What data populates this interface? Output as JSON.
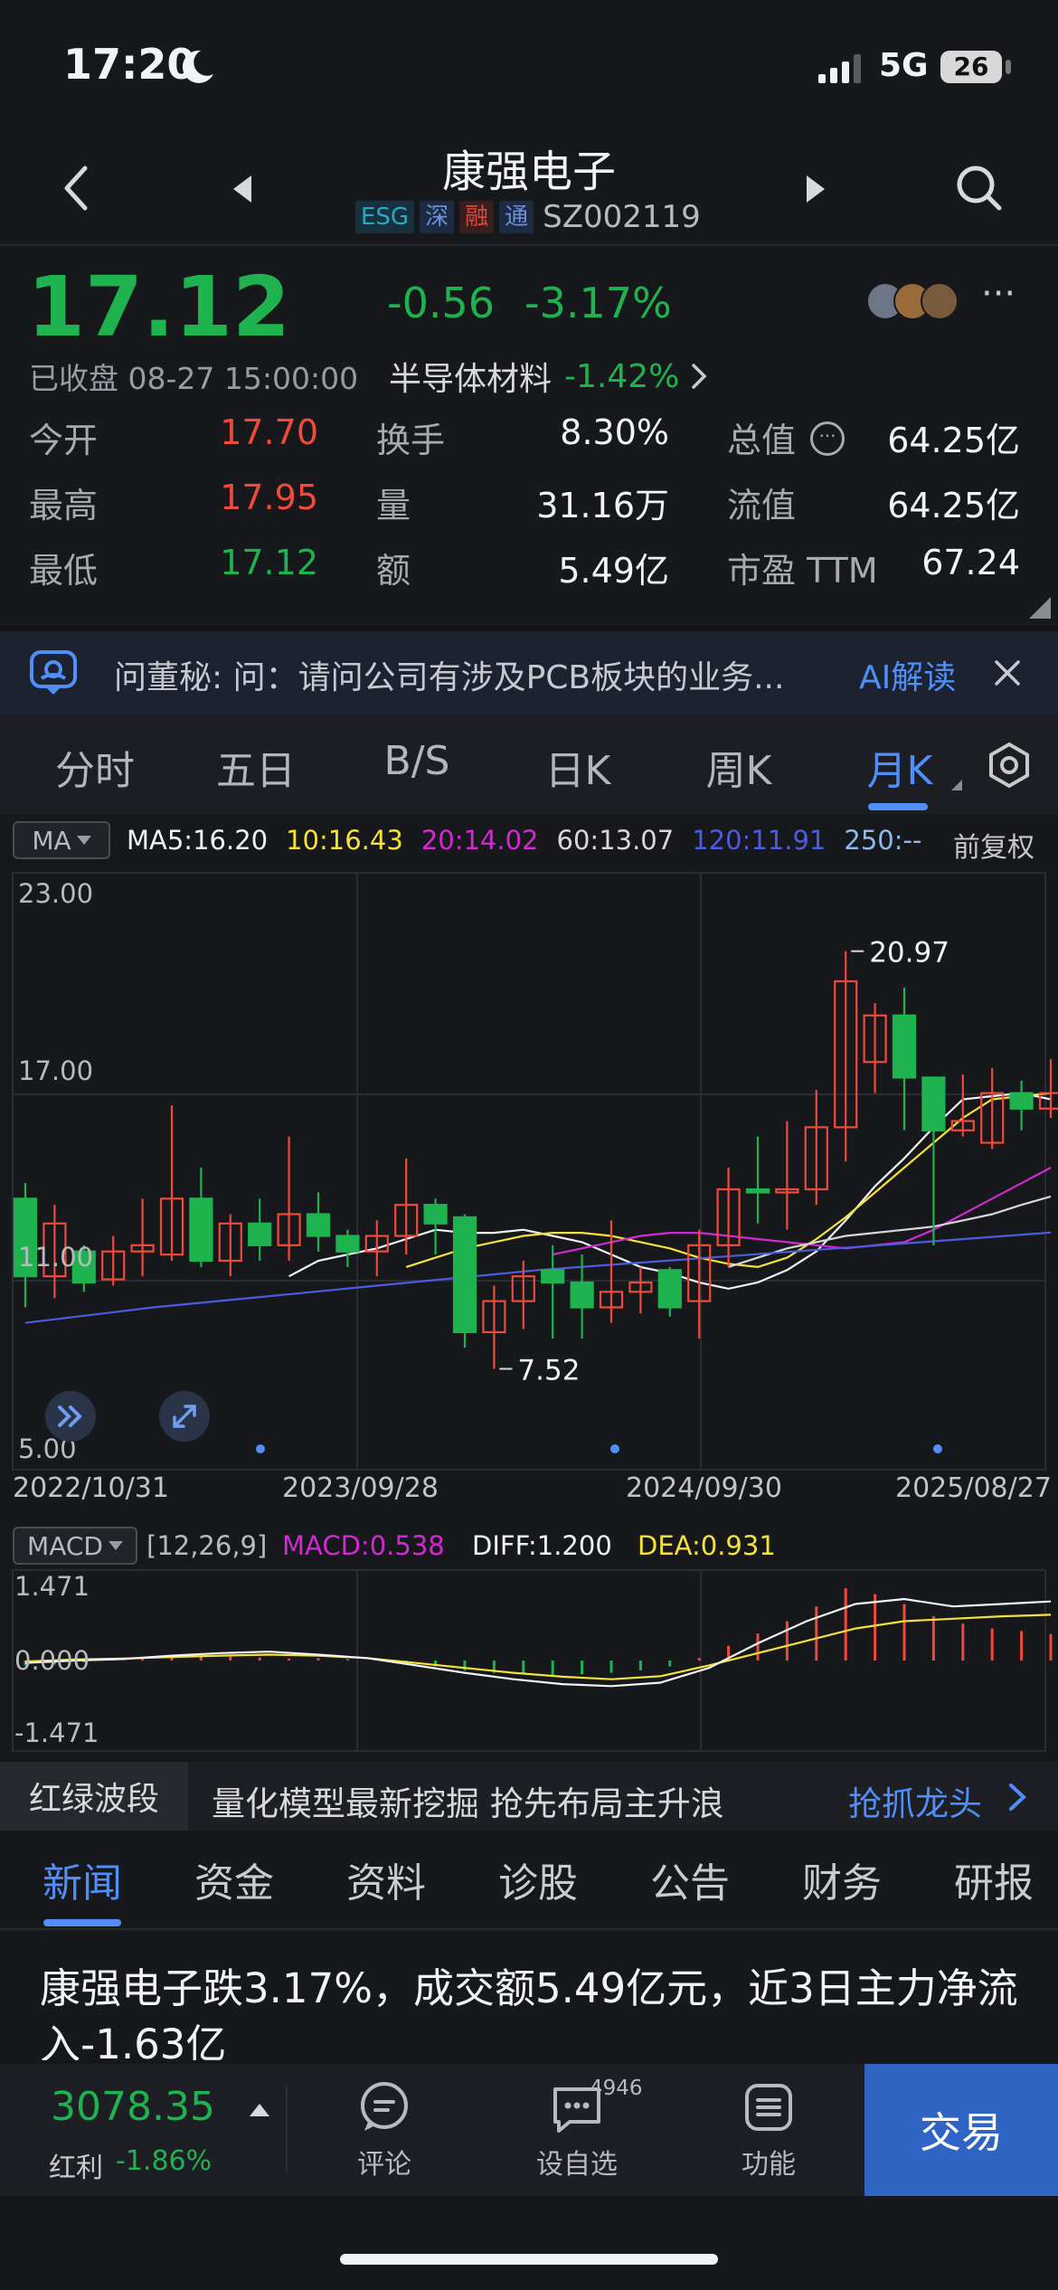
{
  "status_bar": {
    "time": "17:20",
    "network": "5G",
    "battery": "26"
  },
  "header": {
    "title": "康强电子",
    "tags": [
      {
        "text": "ESG",
        "color": "#28a8c8",
        "bg": "#17323e"
      },
      {
        "text": "深",
        "color": "#6b8fd8",
        "bg": "#1d2a44"
      },
      {
        "text": "融",
        "color": "#e0463a",
        "bg": "#3a1d1d"
      },
      {
        "text": "通",
        "color": "#6b8fd8",
        "bg": "#1d2a44"
      }
    ],
    "code": "SZ002119"
  },
  "quote": {
    "price": "17.12",
    "change": "-0.56",
    "change_pct": "-3.17%",
    "status": "已收盘 08-27 15:00:00",
    "sector_name": "半导体材料",
    "sector_pct": "-1.42%",
    "stats": [
      {
        "label": "今开",
        "value": "17.70",
        "color": "red"
      },
      {
        "label": "最高",
        "value": "17.95",
        "color": "red"
      },
      {
        "label": "最低",
        "value": "17.12",
        "color": "green"
      },
      {
        "label": "换手",
        "value": "8.30%",
        "color": "white"
      },
      {
        "label": "量",
        "value": "31.16万",
        "color": "white"
      },
      {
        "label": "额",
        "value": "5.49亿",
        "color": "white"
      },
      {
        "label": "总值",
        "value": "64.25亿",
        "color": "white"
      },
      {
        "label": "流值",
        "value": "64.25亿",
        "color": "white"
      },
      {
        "label": "市盈 TTM",
        "value": "67.24",
        "color": "white"
      }
    ]
  },
  "assistant_bar": {
    "text": "问董秘: 问：请问公司有涉及PCB板块的业务...",
    "action": "AI解读"
  },
  "chart_tabs": [
    "分时",
    "五日",
    "B/S",
    "日K",
    "周K",
    "月K"
  ],
  "active_tab": "月K",
  "ma_legend": {
    "selector": "MA",
    "items": [
      {
        "text": "MA5:16.20",
        "color": "#f2f3f5"
      },
      {
        "text": "10:16.43",
        "color": "#f5e13a"
      },
      {
        "text": "20:14.02",
        "color": "#d02ad0"
      },
      {
        "text": "60:13.07",
        "color": "#d8d8d8"
      },
      {
        "text": "120:11.91",
        "color": "#4d5be0"
      },
      {
        "text": "250:--",
        "color": "#8fb9f0"
      }
    ],
    "adjust": "前复权"
  },
  "chart_data": {
    "type": "candlestick",
    "y_axis_labels": [
      "23.00",
      "17.00",
      "11.00",
      "5.00"
    ],
    "ylim": [
      5.0,
      23.0
    ],
    "x_labels": [
      "2022/10/31",
      "2023/09/28",
      "2024/09/30",
      "2025/08/27"
    ],
    "annotations": [
      {
        "text": "20.97"
      },
      {
        "text": "7.52"
      }
    ],
    "candles": [
      [
        13.0,
        10.5,
        13.5,
        9.5
      ],
      [
        10.5,
        12.2,
        12.8,
        9.8
      ],
      [
        11.3,
        10.3,
        11.5,
        10.0
      ],
      [
        10.4,
        11.3,
        11.8,
        10.2
      ],
      [
        11.3,
        11.5,
        13.0,
        10.5
      ],
      [
        11.2,
        13.0,
        16.0,
        11.0
      ],
      [
        13.0,
        11.0,
        14.0,
        10.8
      ],
      [
        11.0,
        12.2,
        12.5,
        10.5
      ],
      [
        12.2,
        11.5,
        13.0,
        11.0
      ],
      [
        11.5,
        12.5,
        15.0,
        11.0
      ],
      [
        12.5,
        11.8,
        13.2,
        11.3
      ],
      [
        11.8,
        11.3,
        12.0,
        10.8
      ],
      [
        11.3,
        11.8,
        12.3,
        10.5
      ],
      [
        11.8,
        12.8,
        14.3,
        11.2
      ],
      [
        12.8,
        12.2,
        13.0,
        11.2
      ],
      [
        12.4,
        8.7,
        12.5,
        8.2
      ],
      [
        8.7,
        9.7,
        10.2,
        7.52
      ],
      [
        9.7,
        10.5,
        11.0,
        8.8
      ],
      [
        10.7,
        10.3,
        11.5,
        8.5
      ],
      [
        10.3,
        9.5,
        11.2,
        8.5
      ],
      [
        9.5,
        10.0,
        12.3,
        9.0
      ],
      [
        10.0,
        10.3,
        10.8,
        9.3
      ],
      [
        10.7,
        9.5,
        10.8,
        9.2
      ],
      [
        9.7,
        11.5,
        12.0,
        8.5
      ],
      [
        11.5,
        13.3,
        14.0,
        10.8
      ],
      [
        13.3,
        13.2,
        15.0,
        12.2
      ],
      [
        13.2,
        13.3,
        15.5,
        12.0
      ],
      [
        13.3,
        15.3,
        16.5,
        12.8
      ],
      [
        15.3,
        20.0,
        20.97,
        14.2
      ],
      [
        17.4,
        18.9,
        19.3,
        16.4
      ],
      [
        18.9,
        16.9,
        19.8,
        15.2
      ],
      [
        16.9,
        15.2,
        16.9,
        11.5
      ],
      [
        15.2,
        15.5,
        17.0,
        15.0
      ],
      [
        14.8,
        16.4,
        17.2,
        14.6
      ],
      [
        16.4,
        15.9,
        16.8,
        15.2
      ],
      [
        15.9,
        16.4,
        17.5,
        15.6
      ]
    ],
    "ma_series": {
      "ma5": [
        10.5,
        11.0,
        11.2,
        11.4,
        11.7,
        12.0,
        11.9,
        11.9,
        12.0,
        11.8,
        11.6,
        11.2,
        10.8,
        10.6,
        10.3,
        10.1,
        10.3,
        10.7,
        11.3,
        12.3,
        13.4,
        14.3,
        15.3,
        16.2,
        16.3,
        16.4,
        16.2
      ],
      "ma10": [
        10.8,
        11.1,
        11.4,
        11.6,
        11.8,
        11.9,
        11.9,
        11.8,
        11.6,
        11.4,
        11.1,
        10.9,
        10.8,
        11.1,
        11.7,
        12.4,
        13.2,
        14.0,
        14.8,
        15.6,
        16.2,
        16.3,
        16.4
      ],
      "ma20": [
        11.2,
        11.4,
        11.6,
        11.8,
        11.9,
        11.9,
        11.8,
        11.7,
        11.6,
        11.5,
        11.4,
        11.5,
        11.6,
        12.0,
        12.5,
        13.0,
        13.5,
        14.0
      ],
      "ma60": [
        10.8,
        11.1,
        11.4,
        11.6,
        11.8,
        11.9,
        12.0,
        12.1,
        12.3,
        12.5,
        12.8,
        13.07
      ],
      "ma120": [
        9.0,
        9.5,
        9.9,
        10.3,
        10.7,
        11.0,
        11.3,
        11.6,
        11.91
      ]
    },
    "macd": {
      "params": "[12,26,9]",
      "macd_label": "MACD:0.538",
      "diff_label": "DIFF:1.200",
      "dea_label": "DEA:0.931",
      "y_labels": [
        "1.471",
        "0.000",
        "-1.471"
      ],
      "histogram": [
        -0.1,
        -0.08,
        -0.04,
        0.02,
        0.05,
        0.08,
        0.1,
        0.08,
        0.06,
        0.04,
        0.05,
        0.03,
        0.0,
        -0.05,
        -0.12,
        -0.2,
        -0.25,
        -0.28,
        -0.3,
        -0.28,
        -0.25,
        -0.2,
        -0.12,
        0.05,
        0.3,
        0.55,
        0.8,
        1.1,
        1.471,
        1.35,
        1.15,
        0.9,
        0.75,
        0.65,
        0.6,
        0.538
      ],
      "diff": [
        -0.05,
        0.0,
        0.03,
        0.1,
        0.15,
        0.18,
        0.12,
        0.05,
        -0.1,
        -0.25,
        -0.38,
        -0.48,
        -0.52,
        -0.45,
        -0.15,
        0.35,
        0.8,
        1.15,
        1.25,
        1.1,
        1.15,
        1.2
      ],
      "dea": [
        -0.02,
        0.02,
        0.04,
        0.07,
        0.1,
        0.12,
        0.1,
        0.05,
        -0.05,
        -0.15,
        -0.25,
        -0.33,
        -0.38,
        -0.32,
        -0.1,
        0.15,
        0.4,
        0.65,
        0.8,
        0.85,
        0.9,
        0.931
      ]
    }
  },
  "promo": {
    "label": "红绿波段",
    "text": "量化模型最新挖掘 抢先布局主升浪",
    "link": "抢抓龙头"
  },
  "news_tabs": [
    "新闻",
    "资金",
    "资料",
    "诊股",
    "公告",
    "财务",
    "研报"
  ],
  "active_news_tab": "新闻",
  "news_headline": "康强电子跌3.17%，成交额5.49亿元，近3日主力净流入-1.63亿",
  "bottom_bar": {
    "index_value": "3078.35",
    "index_name": "红利",
    "index_pct": "-1.86%",
    "buttons": [
      "评论",
      "设自选",
      "功能"
    ],
    "watch_count": "4946",
    "trade": "交易"
  }
}
